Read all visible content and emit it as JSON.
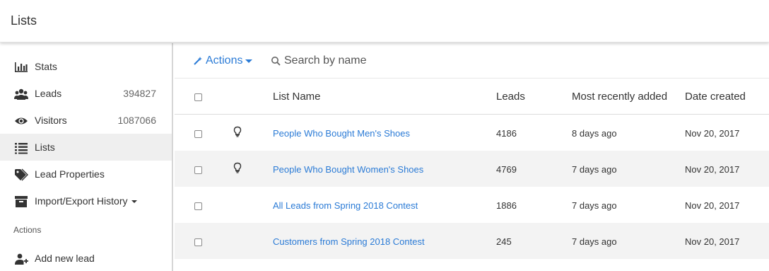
{
  "header": {
    "title": "Lists"
  },
  "sidebar": {
    "items": [
      {
        "label": "Stats",
        "count": "",
        "icon": "bar-chart-icon"
      },
      {
        "label": "Leads",
        "count": "394827",
        "icon": "users-icon"
      },
      {
        "label": "Visitors",
        "count": "1087066",
        "icon": "eye-icon"
      },
      {
        "label": "Lists",
        "count": "",
        "icon": "list-icon",
        "active": true
      },
      {
        "label": "Lead Properties",
        "count": "",
        "icon": "tag-icon"
      },
      {
        "label": "Import/Export History",
        "count": "",
        "icon": "archive-icon"
      }
    ],
    "section_label": "Actions",
    "actions": [
      {
        "label": "Add new lead",
        "icon": "add-user-icon"
      }
    ]
  },
  "toolbar": {
    "actions_label": "Actions",
    "search_placeholder": "Search by name"
  },
  "table": {
    "columns": [
      "List Name",
      "Leads",
      "Most recently added",
      "Date created"
    ],
    "rows": [
      {
        "name": "People Who Bought Men's Shoes",
        "leads": "4186",
        "recent": "8 days ago",
        "created": "Nov 20, 2017",
        "bulb": true
      },
      {
        "name": "People Who Bought Women's Shoes",
        "leads": "4769",
        "recent": "7 days ago",
        "created": "Nov 20, 2017",
        "bulb": true
      },
      {
        "name": "All Leads from Spring 2018 Contest",
        "leads": "1886",
        "recent": "7 days ago",
        "created": "Nov 20, 2017",
        "bulb": false
      },
      {
        "name": "Customers from Spring 2018 Contest",
        "leads": "245",
        "recent": "7 days ago",
        "created": "Nov 20, 2017",
        "bulb": false
      }
    ]
  },
  "colors": {
    "accent": "#2b7bd6",
    "active_bg": "#efefef",
    "stripe": "#f3f3f3"
  }
}
